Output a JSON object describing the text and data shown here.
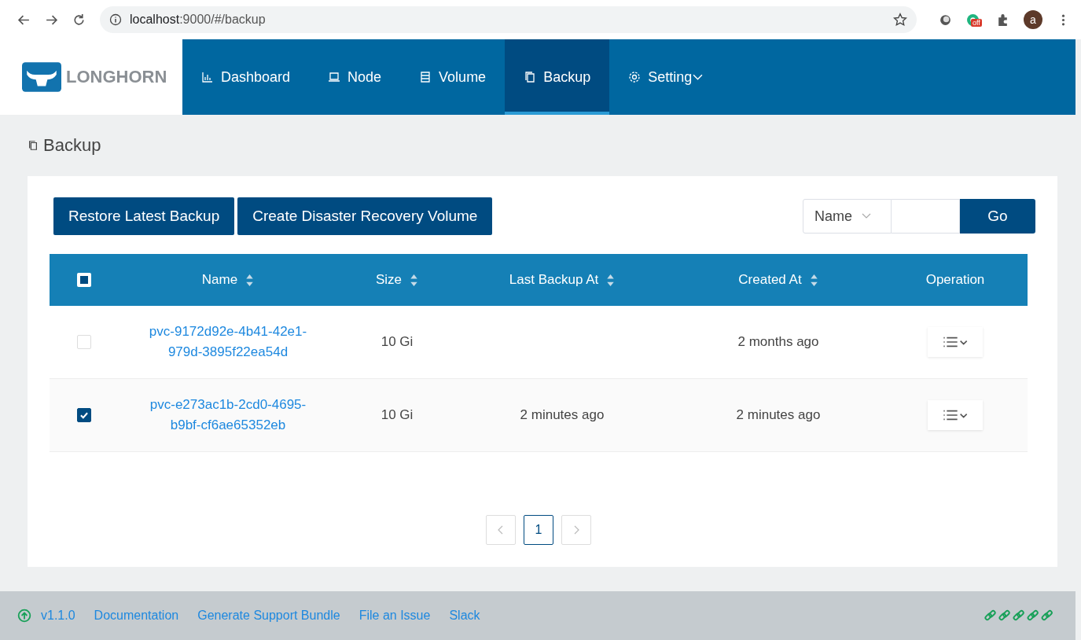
{
  "browser": {
    "url_host": "localhost",
    "url_rest": ":9000/#/backup",
    "extension_badge": "off",
    "avatar": "a"
  },
  "brand": {
    "name": "LONGHORN"
  },
  "nav": [
    {
      "label": "Dashboard",
      "selected": false
    },
    {
      "label": "Node",
      "selected": false
    },
    {
      "label": "Volume",
      "selected": false
    },
    {
      "label": "Backup",
      "selected": true
    },
    {
      "label": "Setting",
      "selected": false,
      "caret": true
    }
  ],
  "page_title": "Backup",
  "actions": [
    "Restore Latest Backup",
    "Create Disaster Recovery Volume"
  ],
  "search": {
    "field": "Name",
    "button": "Go"
  },
  "table": {
    "header_checkbox": {
      "indeterminate": true
    },
    "columns": [
      {
        "label": "Name",
        "sortable": true
      },
      {
        "label": "Size",
        "sortable": true
      },
      {
        "label": "Last Backup At",
        "sortable": true
      },
      {
        "label": "Created At",
        "sortable": true
      },
      {
        "label": "Operation",
        "sortable": false
      }
    ],
    "rows": [
      {
        "selected": false,
        "name": "pvc-9172d92e-4b41-42e1-979d-3895f22ea54d",
        "size": "10 Gi",
        "created": "2 months ago"
      },
      {
        "selected": true,
        "name": "pvc-e273ac1b-2cd0-4695-b9bf-cf6ae65352eb",
        "size": "10 Gi",
        "last_backup": "2 minutes ago",
        "created": "2 minutes ago"
      }
    ]
  },
  "pagination": {
    "pages": [
      {
        "label": "1",
        "selected": true
      }
    ]
  },
  "footer": {
    "version": "v1.1.0",
    "links": [
      "Documentation",
      "Generate Support Bundle",
      "File an Issue",
      "Slack"
    ]
  }
}
